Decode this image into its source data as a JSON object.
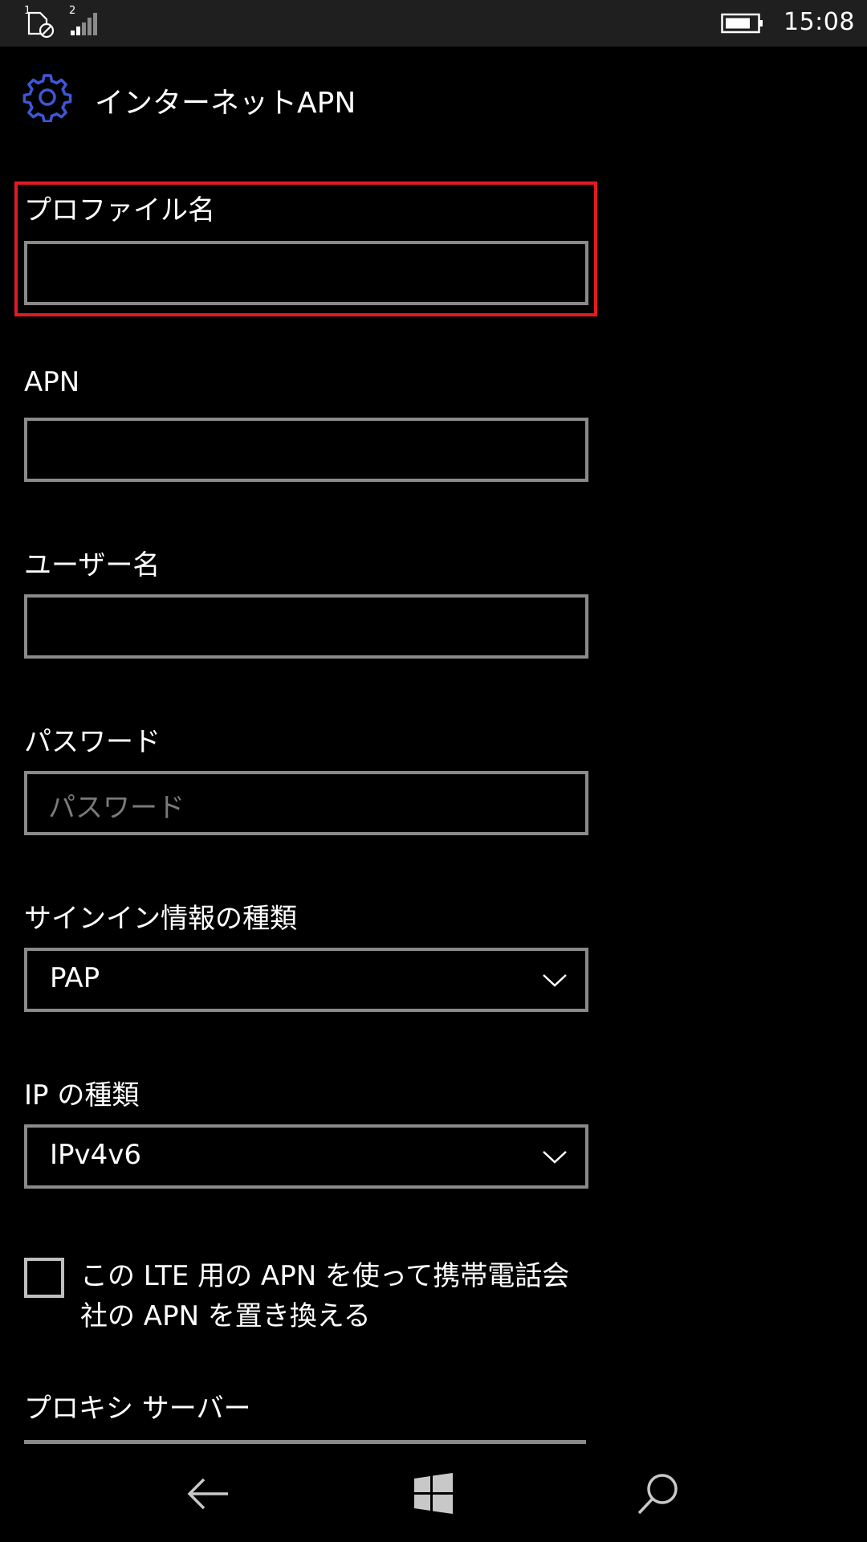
{
  "status_bar": {
    "sim1_index": "1",
    "sim2_index": "2",
    "time": "15:08"
  },
  "header": {
    "title": "インターネットAPN",
    "icon": "gear-icon"
  },
  "form": {
    "profile_name": {
      "label": "プロファイル名",
      "value": ""
    },
    "apn": {
      "label": "APN",
      "value": ""
    },
    "username": {
      "label": "ユーザー名",
      "value": ""
    },
    "password": {
      "label": "パスワード",
      "placeholder": "パスワード"
    },
    "signin_type": {
      "label": "サインイン情報の種類",
      "value": "PAP"
    },
    "ip_type": {
      "label": "IP の種類",
      "value": "IPv4v6"
    },
    "replace_apn": {
      "label_line1": "この LTE 用の APN を使って携帯電話会",
      "label_line2": "社の APN を置き換える",
      "checked": false
    },
    "proxy_server": {
      "label": "プロキシ サーバー"
    }
  },
  "colors": {
    "accent": "#3d57d6",
    "focus_border": "#e11b22",
    "field_border": "#8a8a8a"
  },
  "nav_bar": {
    "icons": [
      "back-arrow-icon",
      "windows-logo-icon",
      "search-icon"
    ]
  }
}
